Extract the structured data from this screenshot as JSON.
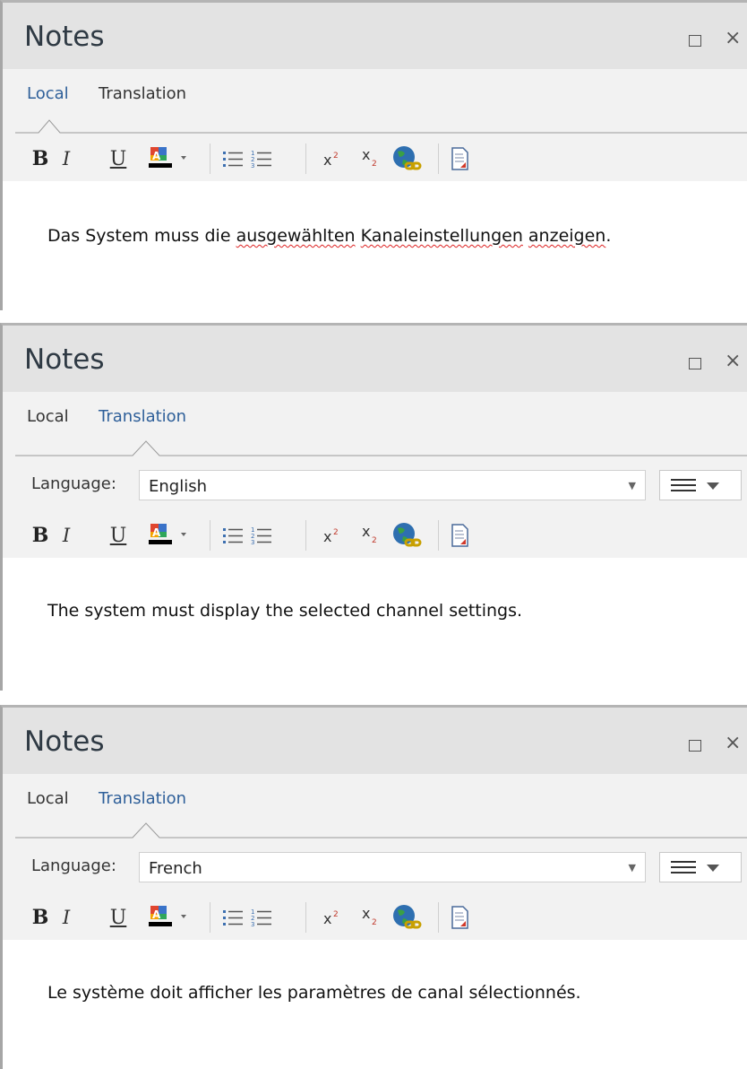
{
  "panels": [
    {
      "title": "Notes",
      "tabs": [
        {
          "label": "Local"
        },
        {
          "label": "Translation"
        }
      ],
      "active_tab": "Local",
      "note": {
        "parts": [
          {
            "text": "Das System muss die "
          },
          {
            "text": "ausgewählten"
          },
          {
            "text": " "
          },
          {
            "text": "Kanaleinstellungen"
          },
          {
            "text": " "
          },
          {
            "text": "anzeigen"
          },
          {
            "text": "."
          }
        ]
      }
    },
    {
      "title": "Notes",
      "tabs": [
        {
          "label": "Local"
        },
        {
          "label": "Translation"
        }
      ],
      "active_tab": "Translation",
      "language": {
        "label": "Language:",
        "value": "English"
      },
      "note": {
        "text": "The system must display the selected channel settings."
      }
    },
    {
      "title": "Notes",
      "tabs": [
        {
          "label": "Local"
        },
        {
          "label": "Translation"
        }
      ],
      "active_tab": "Translation",
      "language": {
        "label": "Language:",
        "value": "French"
      },
      "note": {
        "text": "Le système doit afficher les paramètres de canal sélectionnés."
      }
    }
  ],
  "toolbar": {
    "bold_label": "B",
    "italic_label": "I",
    "underline_label": "U",
    "icons": [
      "bold-icon",
      "italic-icon",
      "underline-icon",
      "font-color-icon",
      "bullet-list-icon",
      "numbered-list-icon",
      "superscript-icon",
      "subscript-icon",
      "globe-link-icon",
      "document-icon"
    ]
  },
  "window_controls": {
    "maximize": "maximize-icon",
    "close_glyph": "×"
  },
  "colors": {
    "accent": "#2e5f99",
    "titlebar": "#e3e3e3",
    "panel_bg": "#f2f2f2",
    "spellcheck": "#dd2222"
  }
}
